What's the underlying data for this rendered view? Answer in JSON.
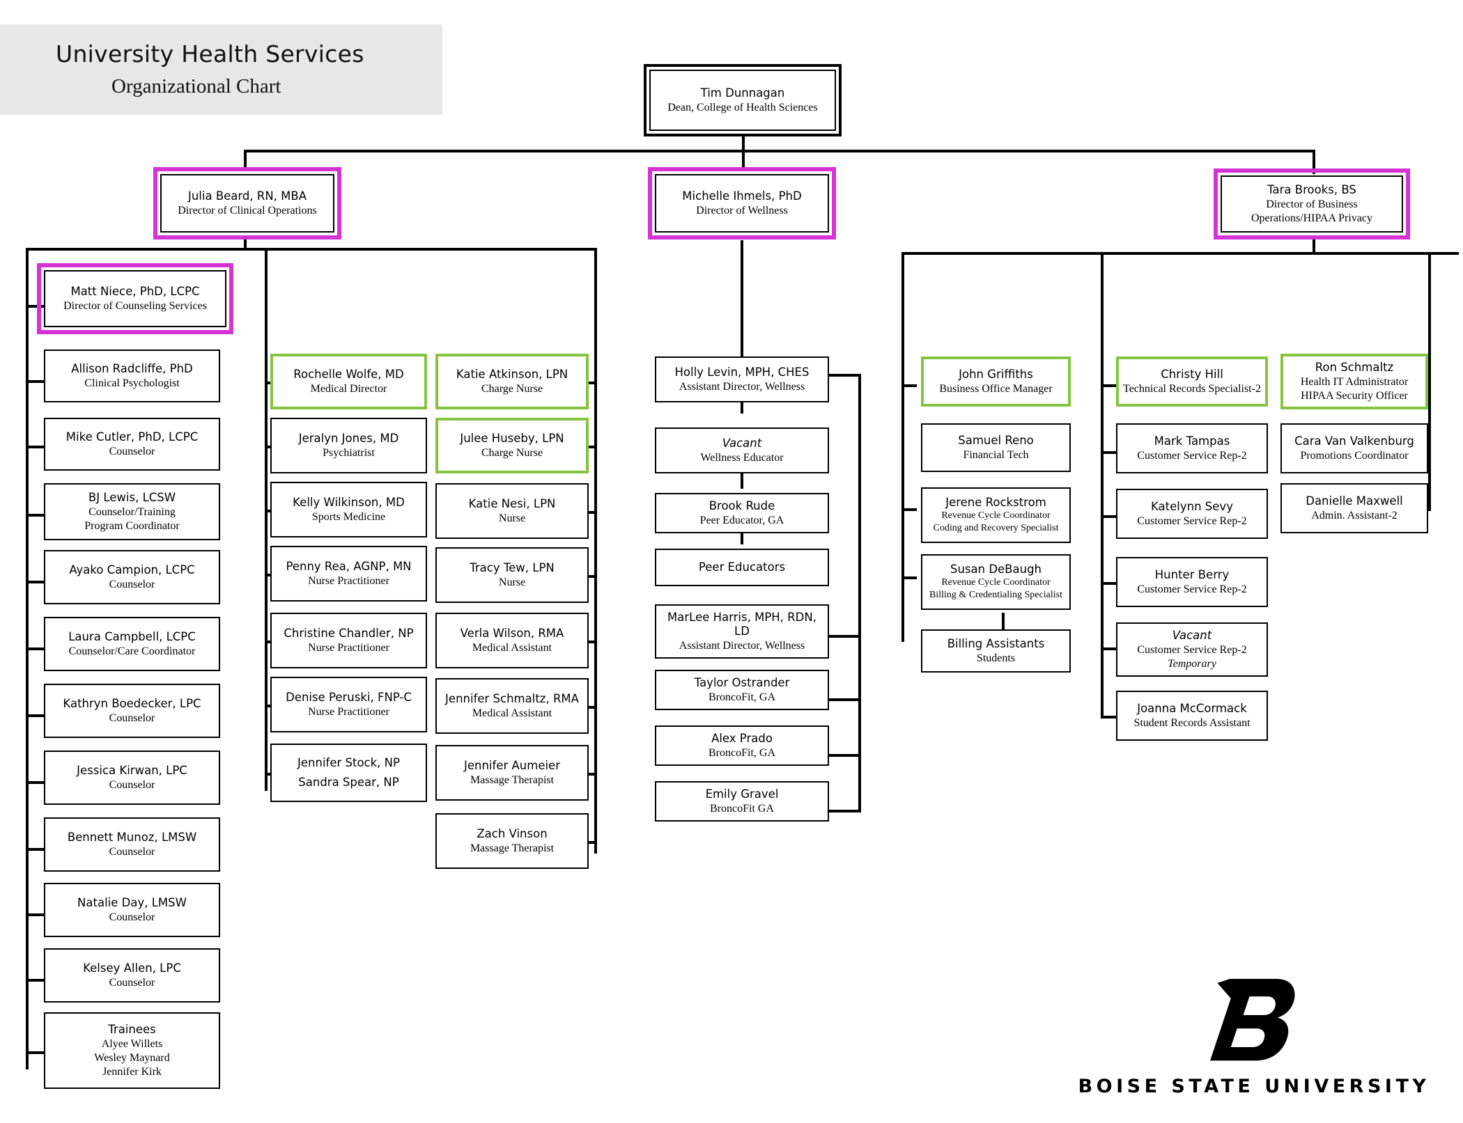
{
  "header": {
    "title_line1": "University Health Services",
    "title_line2": "Organizational Chart"
  },
  "footer": {
    "logo_name": "boise-state-b-logo",
    "wordmark": "BOISE STATE UNIVERSITY"
  },
  "legend_colors": {
    "director_frame": "#d633d6",
    "supervisor_frame": "#85c441",
    "title_band": "#e7e7e7",
    "line": "#000000"
  },
  "nodes": {
    "dean": {
      "name": "Tim Dunnagan",
      "title": "Dean, College of Health Sciences"
    },
    "dir_clinical": {
      "name": "Julia Beard, RN, MBA",
      "title": "Director of Clinical Operations"
    },
    "dir_wellness": {
      "name": "Michelle Ihmels, PhD",
      "title": "Director of Wellness"
    },
    "dir_business": {
      "name": "Tara Brooks, BS",
      "title": "Director of Business",
      "title2": "Operations/HIPAA Privacy"
    },
    "counsel_dir": {
      "name": "Matt Niece, PhD, LCPC",
      "title": "Director of Counseling Services"
    },
    "c1": {
      "name": "Allison Radcliffe, PhD",
      "title": "Clinical Psychologist"
    },
    "c2": {
      "name": "Mike Cutler, PhD, LCPC",
      "title": "Counselor"
    },
    "c3": {
      "name": "BJ Lewis, LCSW",
      "title": "Counselor/Training",
      "title2": "Program Coordinator"
    },
    "c4": {
      "name": "Ayako Campion, LCPC",
      "title": "Counselor"
    },
    "c5": {
      "name": "Laura Campbell, LCPC",
      "title": "Counselor/Care Coordinator"
    },
    "c6": {
      "name": "Kathryn Boedecker, LPC",
      "title": "Counselor"
    },
    "c7": {
      "name": "Jessica Kirwan, LPC",
      "title": "Counselor"
    },
    "c8": {
      "name": "Bennett Munoz, LMSW",
      "title": "Counselor"
    },
    "c9": {
      "name": "Natalie Day, LMSW",
      "title": "Counselor"
    },
    "c10": {
      "name": "Kelsey Allen, LPC",
      "title": "Counselor"
    },
    "c11": {
      "name": "Trainees",
      "title": "Alyee Willets",
      "title2": "Wesley Maynard",
      "title3": "Jennifer Kirk"
    },
    "m1": {
      "name": "Rochelle Wolfe, MD",
      "title": "Medical Director"
    },
    "m2": {
      "name": "Jeralyn Jones, MD",
      "title": "Psychiatrist"
    },
    "m3": {
      "name": "Kelly Wilkinson, MD",
      "title": "Sports Medicine"
    },
    "m4": {
      "name": "Penny Rea, AGNP, MN",
      "title": "Nurse Practitioner"
    },
    "m5": {
      "name": "Christine Chandler, NP",
      "title": "Nurse Practitioner"
    },
    "m6": {
      "name": "Denise Peruski, FNP-C",
      "title": "Nurse Practitioner"
    },
    "m7": {
      "name": "Jennifer Stock, NP",
      "name2": "Sandra Spear, NP"
    },
    "n1": {
      "name": "Katie Atkinson, LPN",
      "title": "Charge Nurse"
    },
    "n2": {
      "name": "Julee Huseby, LPN",
      "title": "Charge Nurse"
    },
    "n3": {
      "name": "Katie Nesi, LPN",
      "title": "Nurse"
    },
    "n4": {
      "name": "Tracy Tew, LPN",
      "title": "Nurse"
    },
    "n5": {
      "name": "Verla Wilson, RMA",
      "title": "Medical Assistant"
    },
    "n6": {
      "name": "Jennifer Schmaltz, RMA",
      "title": "Medical Assistant"
    },
    "n7": {
      "name": "Jennifer Aumeier",
      "title": "Massage Therapist"
    },
    "n8": {
      "name": "Zach Vinson",
      "title": "Massage Therapist"
    },
    "w1": {
      "name": "Holly Levin, MPH, CHES",
      "title": "Assistant Director, Wellness"
    },
    "w2": {
      "name": "Vacant",
      "name_italic": true,
      "title": "Wellness Educator"
    },
    "w3": {
      "name": "Brook Rude",
      "title": "Peer Educator, GA"
    },
    "w4": {
      "name": "Peer Educators"
    },
    "w5": {
      "name": "MarLee Harris, MPH, RDN,",
      "name2": "LD",
      "title": "Assistant Director, Wellness"
    },
    "w6": {
      "name": "Taylor Ostrander",
      "title": "BroncoFit, GA"
    },
    "w7": {
      "name": "Alex Prado",
      "title": "BroncoFit, GA"
    },
    "w8": {
      "name": "Emily Gravel",
      "title": "BroncoFit GA"
    },
    "b1": {
      "name": "John Griffiths",
      "title": "Business Office Manager"
    },
    "b2": {
      "name": "Samuel Reno",
      "title": "Financial Tech"
    },
    "b3": {
      "name": "Jerene Rockstrom",
      "title": "Revenue Cycle Coordinator",
      "title2": "Coding and Recovery Specialist"
    },
    "b4": {
      "name": "Susan DeBaugh",
      "title": "Revenue Cycle Coordinator",
      "title2": "Billing & Credentialing Specialist"
    },
    "b5": {
      "name": "Billing Assistants",
      "title": "Students"
    },
    "s1": {
      "name": "Christy Hill",
      "title": "Technical Records Specialist-2"
    },
    "s2": {
      "name": "Mark Tampas",
      "title": "Customer Service Rep-2"
    },
    "s3": {
      "name": "Katelynn Sevy",
      "title": "Customer Service Rep-2"
    },
    "s4": {
      "name": "Hunter Berry",
      "title": "Customer Service Rep-2"
    },
    "s5": {
      "name": "Vacant",
      "name_italic": true,
      "title": "Customer Service Rep-2",
      "title2": "Temporary",
      "title2_italic": true
    },
    "s6": {
      "name": "Joanna McCormack",
      "title": "Student Records Assistant"
    },
    "i1": {
      "name": "Ron Schmaltz",
      "title": "Health IT Administrator",
      "title2": "HIPAA Security Officer"
    },
    "i2": {
      "name": "Cara Van Valkenburg",
      "title": "Promotions Coordinator"
    },
    "i3": {
      "name": "Danielle Maxwell",
      "title": "Admin. Assistant-2"
    }
  }
}
